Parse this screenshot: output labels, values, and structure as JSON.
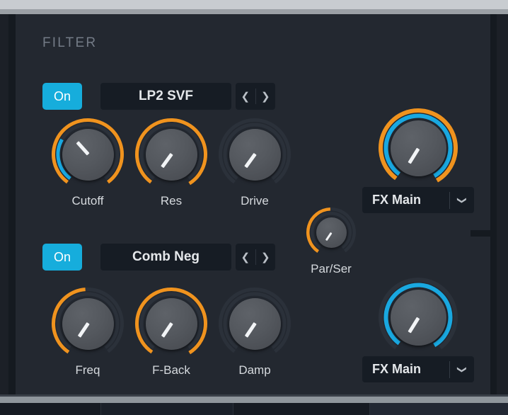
{
  "window": {
    "bottom_cells": [
      "",
      "",
      "",
      ""
    ]
  },
  "filter_section": {
    "title": "FILTER",
    "filter1": {
      "on_label": "On",
      "type_name": "LP2 SVF",
      "prev_icon": "chevron-left-icon",
      "next_icon": "chevron-right-icon",
      "knobs": [
        {
          "label": "Cutoff",
          "value_deg": 318,
          "arc_start": 216,
          "arc_end": 144,
          "arc_color": "#f0931e",
          "mod_start": 216,
          "mod_end": 300,
          "mod_color": "#19a8e0"
        },
        {
          "label": "Res",
          "value_deg": 216,
          "arc_start": 216,
          "arc_end": 148,
          "arc_color": "#f0931e",
          "mod_start": 0,
          "mod_end": 0,
          "mod_color": "#19a8e0"
        },
        {
          "label": "Drive",
          "value_deg": 216,
          "arc_start": 0,
          "arc_end": 0,
          "arc_color": "#f0931e",
          "mod_start": 0,
          "mod_end": 0,
          "mod_color": "#19a8e0"
        }
      ],
      "fx_knob": {
        "label": "FX Main",
        "value_deg": 212,
        "arc_start": 216,
        "arc_end": 150,
        "arc_color": "#f0931e",
        "mod_start": 216,
        "mod_end": 150,
        "mod_color": "#19a8e0",
        "chevron_icon": "chevron-down-icon"
      }
    },
    "routing": {
      "label": "Par/Ser",
      "value_deg": 214,
      "arc_start": 214,
      "arc_end": 358,
      "arc_color": "#f0931e"
    },
    "filter2": {
      "on_label": "On",
      "type_name": "Comb Neg",
      "prev_icon": "chevron-left-icon",
      "next_icon": "chevron-right-icon",
      "knobs": [
        {
          "label": "Freq",
          "value_deg": 214,
          "arc_start": 214,
          "arc_end": 356,
          "arc_color": "#f0931e",
          "mod_start": 0,
          "mod_end": 0,
          "mod_color": "#19a8e0"
        },
        {
          "label": "F-Back",
          "value_deg": 214,
          "arc_start": 214,
          "arc_end": 148,
          "arc_color": "#f0931e",
          "mod_start": 0,
          "mod_end": 0,
          "mod_color": "#19a8e0"
        },
        {
          "label": "Damp",
          "value_deg": 214,
          "arc_start": 0,
          "arc_end": 0,
          "arc_color": "#f0931e",
          "mod_start": 0,
          "mod_end": 0,
          "mod_color": "#19a8e0"
        }
      ],
      "fx_knob": {
        "label": "FX Main",
        "value_deg": 212,
        "arc_start": 0,
        "arc_end": 0,
        "arc_color": "#f0931e",
        "mod_start": 216,
        "mod_end": 150,
        "mod_color": "#19a8e0",
        "chevron_icon": "chevron-down-icon"
      }
    }
  }
}
